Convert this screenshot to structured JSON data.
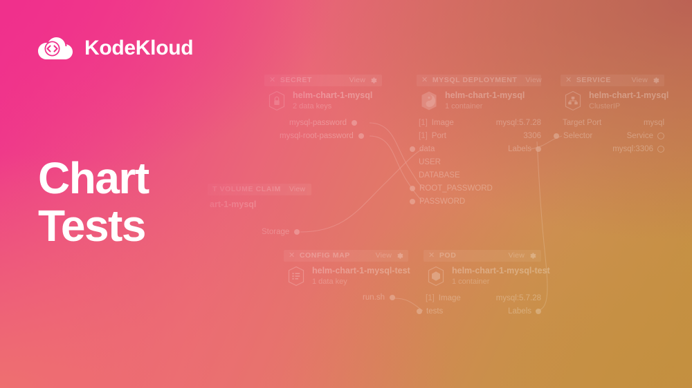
{
  "brand": {
    "name": "KodeKloud",
    "logo_icon": "cloud-code-icon"
  },
  "headline": {
    "line1": "Chart",
    "line2": "Tests"
  },
  "diagram": {
    "common": {
      "view_label": "View",
      "close_icon": "close-icon",
      "gear_icon": "gear-icon"
    },
    "nodes": [
      {
        "id": "secret",
        "title": "SECRET",
        "name": "helm-chart-1-mysql",
        "subtitle": "2 data keys",
        "icon": "secret-hexagon-icon",
        "ports": [
          {
            "label": "mysql-password"
          },
          {
            "label": "mysql-root-password"
          }
        ]
      },
      {
        "id": "mysql-deployment",
        "title": "MYSQL DEPLOYMENT",
        "name": "helm-chart-1-mysql",
        "subtitle": "1 container",
        "icon": "deployment-hexagon-icon",
        "rows": [
          {
            "index": "[1]",
            "key": "Image",
            "value": "mysql:5.7.28"
          },
          {
            "index": "[1]",
            "key": "Port",
            "value": "3306"
          },
          {
            "key": "data",
            "value": "Labels",
            "key_port": true,
            "value_port": true
          },
          {
            "key": "USER",
            "indent": true
          },
          {
            "key": "DATABASE",
            "indent": true
          },
          {
            "key": "ROOT_PASSWORD",
            "key_port": true
          },
          {
            "key": "PASSWORD",
            "key_port": true
          }
        ]
      },
      {
        "id": "service",
        "title": "SERVICE",
        "name": "helm-chart-1-mysql",
        "subtitle": "ClusterIP",
        "icon": "service-hexagon-icon",
        "rows": [
          {
            "key": "Target Port",
            "value": "mysql"
          },
          {
            "key": "Selector",
            "value": "Service",
            "key_port": true,
            "value_port_hollow": true
          },
          {
            "value": "mysql:3306",
            "value_port_hollow": true
          }
        ]
      },
      {
        "id": "persistent-volume-claim",
        "title": "T VOLUME CLAIM",
        "name": "art-1-mysql",
        "icon": "pvc-hexagon-icon",
        "ports": [
          {
            "label": "Storage"
          }
        ]
      },
      {
        "id": "config-map",
        "title": "CONFIG MAP",
        "name": "helm-chart-1-mysql-test",
        "subtitle": "1 data key",
        "icon": "configmap-hexagon-icon",
        "ports": [
          {
            "label": "run.sh"
          }
        ]
      },
      {
        "id": "pod",
        "title": "POD",
        "name": "helm-chart-1-mysql-test",
        "subtitle": "1 container",
        "icon": "pod-hexagon-icon",
        "rows": [
          {
            "index": "[1]",
            "key": "Image",
            "value": "mysql:5.7.28"
          },
          {
            "key": "tests",
            "value": "Labels",
            "key_port": true,
            "value_port": true
          }
        ]
      }
    ]
  },
  "colors": {
    "gradient_top_left": "#F0308C",
    "gradient_top_right": "#B85A55",
    "gradient_bottom_left": "#EE716F",
    "gradient_bottom_right": "#C49340",
    "text_on_gradient": "#FFFFFF"
  }
}
